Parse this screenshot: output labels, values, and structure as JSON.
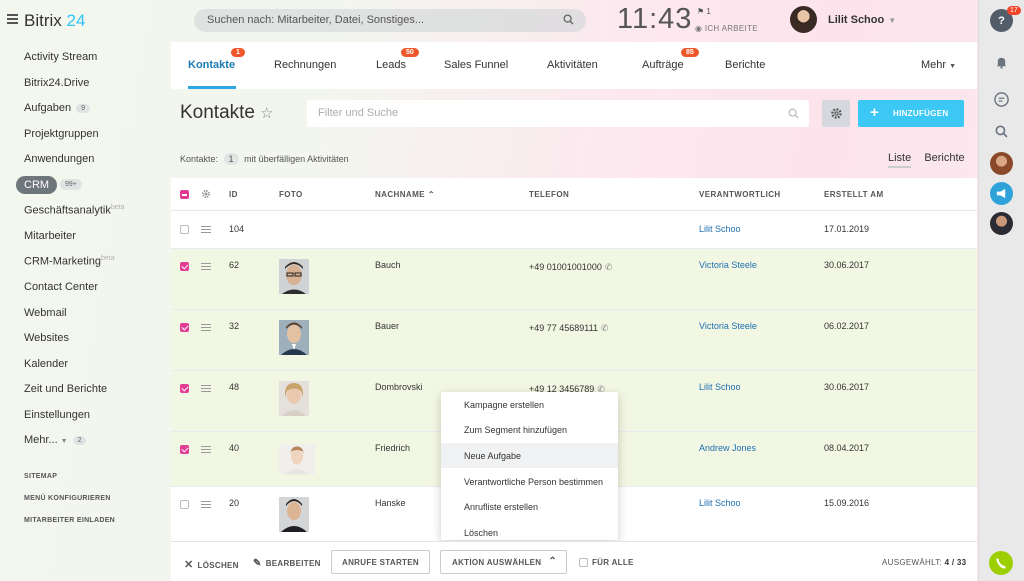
{
  "header": {
    "logo_brand": "Bitrix",
    "logo_number": "24",
    "search_placeholder": "Suchen nach: Mitarbeiter, Datei, Sonstiges...",
    "clock": "11:43",
    "flag_count": "1",
    "work_status": "ICH ARBEITE",
    "user_name": "Lilit Schoo"
  },
  "sidebar": {
    "items": [
      {
        "label": "Activity Stream"
      },
      {
        "label": "Bitrix24.Drive"
      },
      {
        "label": "Aufgaben",
        "count": "9"
      },
      {
        "label": "Projektgruppen"
      },
      {
        "label": "Anwendungen"
      },
      {
        "label": "CRM",
        "count": "99+"
      },
      {
        "label": "Geschäftsanalytik",
        "sup": "beta"
      },
      {
        "label": "Mitarbeiter"
      },
      {
        "label": "CRM-Marketing",
        "sup": "beta"
      },
      {
        "label": "Contact Center"
      },
      {
        "label": "Webmail"
      },
      {
        "label": "Websites"
      },
      {
        "label": "Kalender"
      },
      {
        "label": "Zeit und Berichte"
      },
      {
        "label": "Einstellungen"
      },
      {
        "label": "Mehr...",
        "count": "2"
      }
    ],
    "footer_links": [
      "SITEMAP",
      "MENÜ KONFIGURIEREN",
      "MITARBEITER EINLADEN"
    ]
  },
  "right_strip": {
    "notification_count": "17"
  },
  "tabs": [
    {
      "label": "Kontakte",
      "badge": "1",
      "active": true
    },
    {
      "label": "Rechnungen"
    },
    {
      "label": "Leads",
      "badge": "50"
    },
    {
      "label": "Sales Funnel"
    },
    {
      "label": "Aktivitäten"
    },
    {
      "label": "Aufträge",
      "badge": "85"
    },
    {
      "label": "Berichte"
    },
    {
      "label": "Mehr"
    }
  ],
  "page": {
    "title": "Kontakte",
    "filter_placeholder": "Filter und Suche",
    "add_button": "HINZUFÜGEN",
    "summary_prefix": "Kontakte:",
    "summary_count": "1",
    "summary_suffix": "mit überfälligen Aktivitäten",
    "view_list": "Liste",
    "view_reports": "Berichte"
  },
  "grid": {
    "columns": [
      "ID",
      "FOTO",
      "NACHNAME",
      "TELEFON",
      "VERANTWORTLICH",
      "ERSTELLT AM"
    ],
    "rows": [
      {
        "selected": false,
        "id": "104",
        "last_name": "",
        "phone": "",
        "responsible": "Lilit Schoo",
        "created": "17.01.2019"
      },
      {
        "selected": true,
        "id": "62",
        "last_name": "Bauch",
        "phone": "+49 01001001000",
        "responsible": "Victoria Steele",
        "created": "30.06.2017"
      },
      {
        "selected": true,
        "id": "32",
        "last_name": "Bauer",
        "phone": "+49 77 45689111",
        "responsible": "Victoria Steele",
        "created": "06.02.2017"
      },
      {
        "selected": true,
        "id": "48",
        "last_name": "Dombrovski",
        "phone": "+49 12 3456789",
        "responsible": "Lilit Schoo",
        "created": "30.06.2017"
      },
      {
        "selected": true,
        "id": "40",
        "last_name": "Friedrich",
        "phone": "",
        "responsible": "Andrew Jones",
        "created": "08.04.2017"
      },
      {
        "selected": false,
        "id": "20",
        "last_name": "Hanske",
        "phone": "",
        "responsible": "Lilit Schoo",
        "created": "15.09.2016"
      }
    ]
  },
  "dropdown": {
    "items": [
      "Kampagne erstellen",
      "Zum Segment hinzufügen",
      "Neue Aufgabe",
      "Verantwortliche Person bestimmen",
      "Anrufliste erstellen",
      "Löschen"
    ],
    "hovered_index": 2
  },
  "action_bar": {
    "delete": "LÖSCHEN",
    "edit": "BEARBEITEN",
    "start_calls": "ANRUFE STARTEN",
    "choose_action": "AKTION AUSWÄHLEN",
    "for_all": "FÜR ALLE",
    "selected_label": "AUSGEWÄHLT:",
    "selected_value": "4 / 33"
  },
  "colors": {
    "accent": "#3bc8f5",
    "link": "#1f6fb2",
    "checkbox": "#e23d94",
    "badge": "#f0582b",
    "selected_row": "#f2f7e3"
  }
}
